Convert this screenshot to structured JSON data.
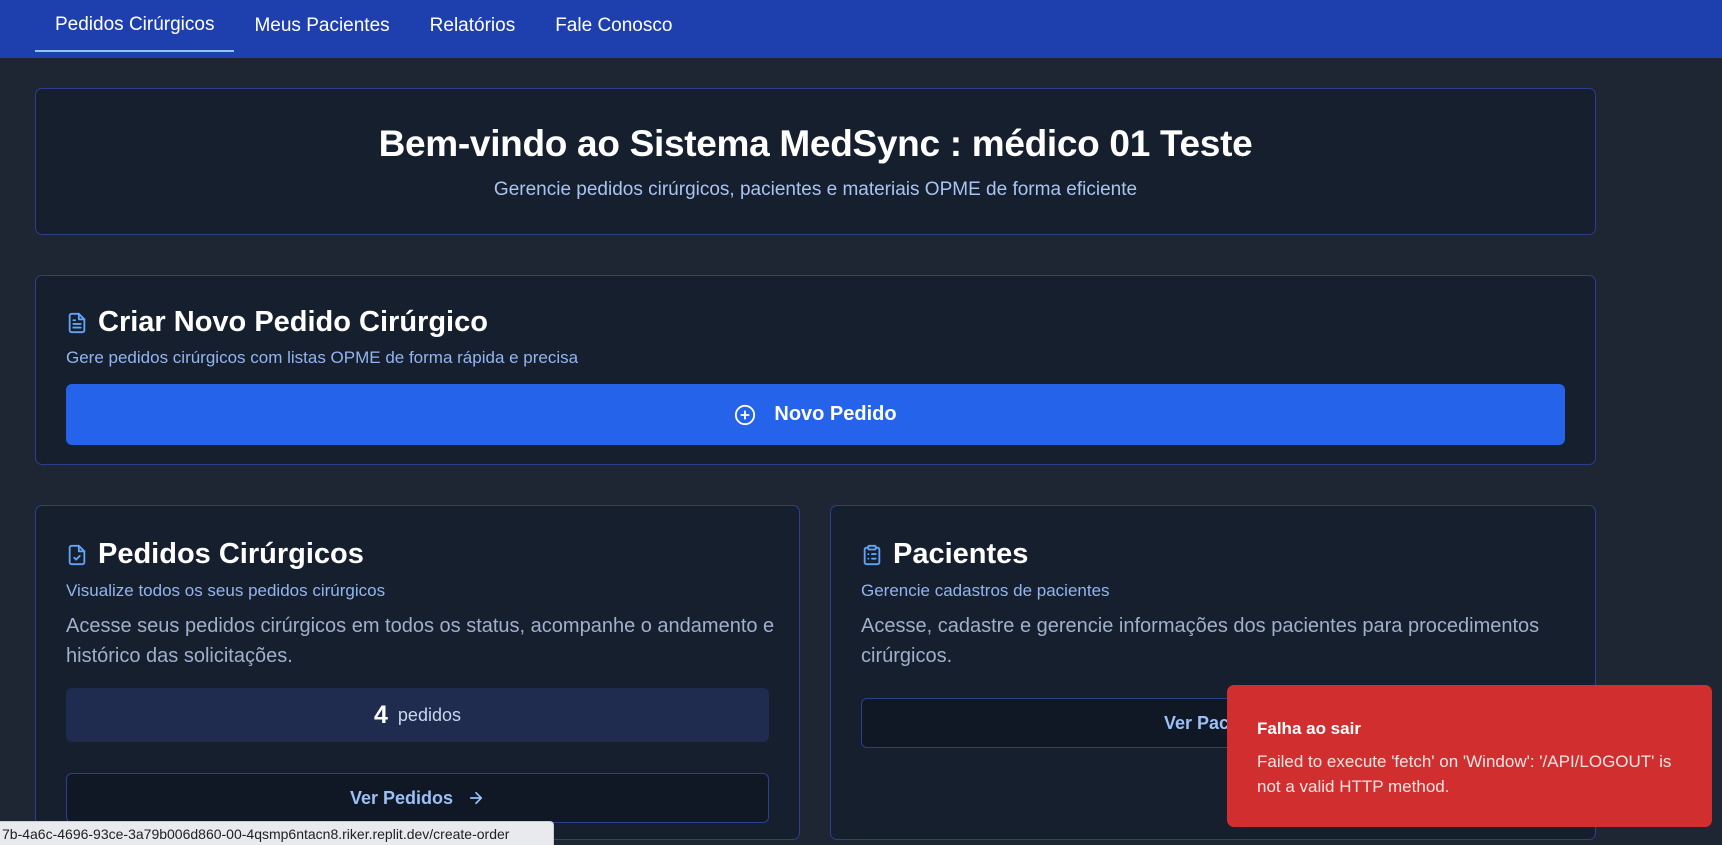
{
  "nav": {
    "tabs": [
      {
        "label": "Pedidos Cirúrgicos",
        "active": true
      },
      {
        "label": "Meus Pacientes"
      },
      {
        "label": "Relatórios"
      },
      {
        "label": "Fale Conosco"
      }
    ]
  },
  "welcome": {
    "title": "Bem-vindo ao Sistema MedSync : médico 01 Teste",
    "subtitle": "Gerencie pedidos cirúrgicos, pacientes e materiais OPME de forma eficiente"
  },
  "create_order": {
    "icon": "file-text-icon",
    "title": "Criar Novo Pedido Cirúrgico",
    "subtitle": "Gere pedidos cirúrgicos com listas OPME de forma rápida e precisa",
    "button_label": "Novo Pedido",
    "button_icon": "plus-circle-icon"
  },
  "orders": {
    "icon": "file-check-icon",
    "title": "Pedidos Cirúrgicos",
    "subtitle": "Visualize todos os seus pedidos cirúrgicos",
    "description": "Acesse seus pedidos cirúrgicos em todos os status, acompanhe o andamento e histórico das solicitações.",
    "count": "4",
    "count_unit": "pedidos",
    "button_label": "Ver Pedidos",
    "button_icon": "arrow-right-icon"
  },
  "patients": {
    "icon": "clipboard-list-icon",
    "title": "Pacientes",
    "subtitle": "Gerencie cadastros de pacientes",
    "description": "Acesse, cadastre e gerencie informações dos pacientes para procedimentos cirúrgicos.",
    "button_label_visible": "Ver Pacient"
  },
  "toast": {
    "title": "Falha ao sair",
    "message": "Failed to execute 'fetch' on 'Window': '/API/LOGOUT' is not a valid HTTP method."
  },
  "status_bar": {
    "url": "7b-4a6c-4696-93ce-3a79b006d860-00-4qsmp6ntacn8.riker.replit.dev/create-order"
  },
  "colors": {
    "nav_bg": "#1e40af",
    "page_bg": "#1e2533",
    "card_bg": "#161f2e",
    "primary": "#2563eb",
    "toast_bg": "#d12f2f"
  }
}
